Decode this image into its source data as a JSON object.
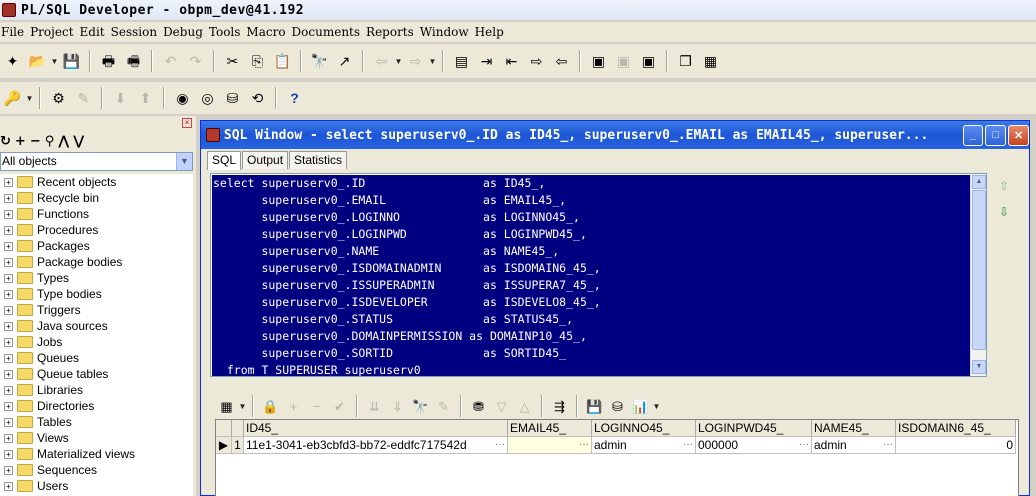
{
  "app": {
    "title": "PL/SQL Developer - obpm_dev@41.192"
  },
  "menu": {
    "items": [
      "File",
      "Project",
      "Edit",
      "Session",
      "Debug",
      "Tools",
      "Macro",
      "Documents",
      "Reports",
      "Window",
      "Help"
    ]
  },
  "toolbar1": {
    "icons": [
      "new-icon",
      "open-icon",
      "save-icon",
      "print-icon",
      "print-preview-icon",
      "undo-icon",
      "redo-icon",
      "cut-icon",
      "copy-icon",
      "paste-icon",
      "find-icon",
      "find-next-icon",
      "back-icon",
      "forward-icon",
      "comment-icon",
      "indent-icon",
      "unindent-icon",
      "uppercase-icon",
      "lowercase-icon",
      "browser-icon",
      "connect-icon",
      "disconnect-icon",
      "window-list-icon",
      "cascade-icon"
    ]
  },
  "toolbar2": {
    "icons": [
      "keys-icon",
      "gear-icon",
      "wand-icon",
      "import-icon",
      "export-icon",
      "db-icon",
      "sql-icon",
      "execute-icon",
      "commit-icon",
      "help-icon"
    ]
  },
  "object_browser": {
    "filter": "All objects",
    "items": [
      "Recent objects",
      "Recycle bin",
      "Functions",
      "Procedures",
      "Packages",
      "Package bodies",
      "Types",
      "Type bodies",
      "Triggers",
      "Java sources",
      "Jobs",
      "Queues",
      "Queue tables",
      "Libraries",
      "Directories",
      "Tables",
      "Views",
      "Materialized views",
      "Sequences",
      "Users"
    ]
  },
  "sql_window": {
    "title": "SQL Window - select superuserv0_.ID as ID45_, superuserv0_.EMAIL as EMAIL45_, superuser...",
    "tabs": [
      "SQL",
      "Output",
      "Statistics"
    ],
    "active_tab": "SQL",
    "sql_lines": [
      "select superuserv0_.ID                 as ID45_,",
      "       superuserv0_.EMAIL              as EMAIL45_,",
      "       superuserv0_.LOGINNO            as LOGINNO45_,",
      "       superuserv0_.LOGINPWD           as LOGINPWD45_,",
      "       superuserv0_.NAME               as NAME45_,",
      "       superuserv0_.ISDOMAINADMIN      as ISDOMAIN6_45_,",
      "       superuserv0_.ISSUPERADMIN       as ISSUPERA7_45_,",
      "       superuserv0_.ISDEVELOPER        as ISDEVELO8_45_,",
      "       superuserv0_.STATUS             as STATUS45_,",
      "       superuserv0_.DOMAINPERMISSION as DOMAINP10_45_,",
      "       superuserv0_.SORTID             as SORTID45_",
      "  from T_SUPERUSER superuserv0_"
    ],
    "grid": {
      "columns": [
        "ID45_",
        "EMAIL45_",
        "LOGINNO45_",
        "LOGINPWD45_",
        "NAME45_",
        "ISDOMAIN6_45_"
      ],
      "rows": [
        {
          "num": "1",
          "cells": [
            "11e1-3041-eb3cbfd3-bb72-eddfc717542d",
            "",
            "admin",
            "000000",
            "admin",
            "0"
          ]
        }
      ]
    }
  },
  "colors": {
    "selection": "#000080",
    "titlebar": "#1d55d6",
    "chrome": "#ece9d8"
  }
}
